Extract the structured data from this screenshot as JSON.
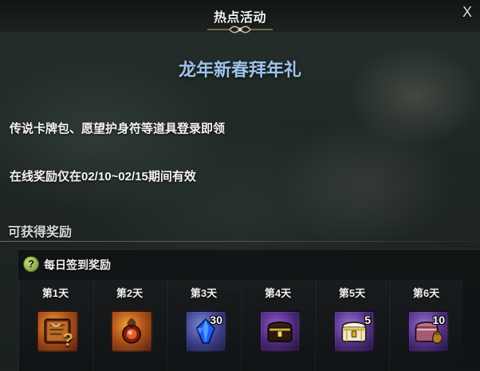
{
  "window": {
    "title": "热点活动",
    "close_label": "X"
  },
  "event": {
    "title": "龙年新春拜年礼",
    "description_lines": [
      "传说卡牌包、愿望护身符等道具登录即领",
      "在线奖励仅在02/10~02/15期间有效"
    ]
  },
  "rewards": {
    "section_title": "可获得奖励",
    "daily_title": "每日签到奖励",
    "days": [
      {
        "label": "第1天",
        "item_icon": "spellbook-icon",
        "quantity": "",
        "slot_color": "orange",
        "badge": "?"
      },
      {
        "label": "第2天",
        "item_icon": "amulet-icon",
        "quantity": "",
        "slot_color": "orange",
        "badge": ""
      },
      {
        "label": "第3天",
        "item_icon": "blue-crystal-icon",
        "quantity": "30",
        "slot_color": "blue",
        "badge": ""
      },
      {
        "label": "第4天",
        "item_icon": "golden-chest-icon",
        "quantity": "",
        "slot_color": "purple",
        "badge": ""
      },
      {
        "label": "第5天",
        "item_icon": "silver-gold-chest-icon",
        "quantity": "5",
        "slot_color": "violet",
        "badge": ""
      },
      {
        "label": "第6天",
        "item_icon": "pink-chest-with-bag-icon",
        "quantity": "10",
        "slot_color": "violet",
        "badge": ""
      }
    ]
  }
}
